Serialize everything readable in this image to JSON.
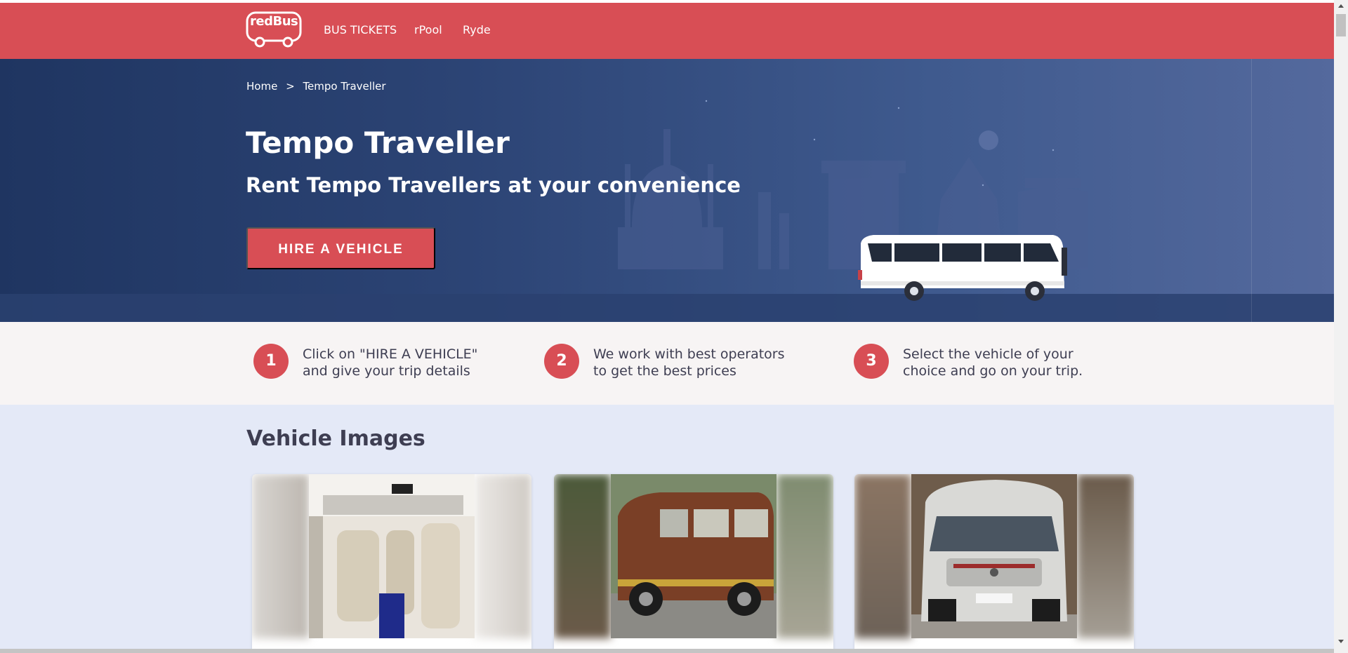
{
  "header": {
    "logo_text": "redBus",
    "nav": [
      "BUS TICKETS",
      "rPool",
      "Ryde"
    ]
  },
  "hero": {
    "breadcrumb": {
      "home": "Home",
      "separator": ">",
      "current": "Tempo Traveller"
    },
    "title": "Tempo Traveller",
    "subtitle": "Rent Tempo Travellers at your convenience",
    "cta_label": "HIRE A VEHICLE"
  },
  "steps": [
    {
      "number": "1",
      "line1": "Click on \"HIRE A VEHICLE\"",
      "line2": "and give your trip details"
    },
    {
      "number": "2",
      "line1": "We work with best operators",
      "line2": "to get the best prices"
    },
    {
      "number": "3",
      "line1": "Select the vehicle of your",
      "line2": "choice and go on your trip."
    }
  ],
  "gallery": {
    "title": "Vehicle Images",
    "images": [
      "tempo-traveller-interior-seats",
      "tempo-traveller-brown-exterior",
      "tempo-traveller-silver-front"
    ]
  },
  "colors": {
    "brand_red": "#d84e55",
    "hero_dark": "#1f3561",
    "hero_light": "#54699d",
    "text_dark": "#3e3e52",
    "steps_bg": "#f7f4f4",
    "gallery_bg": "#e4e9f7"
  }
}
